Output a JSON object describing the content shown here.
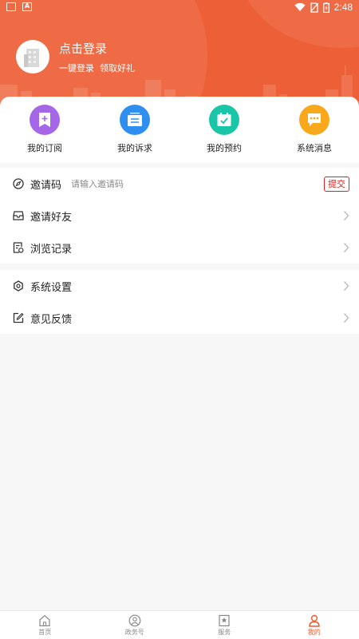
{
  "status_bar": {
    "time": "2:48",
    "left_icons": [
      "image-notification-icon",
      "app-notification-icon"
    ],
    "right_icons": [
      "wifi-icon",
      "no-sim-icon",
      "battery-icon"
    ]
  },
  "header": {
    "login_title": "点击登录",
    "login_subtitle": "一键登录  领取好礼",
    "avatar_icon": "building-icon",
    "background_color": "#ed6037"
  },
  "quick_actions": [
    {
      "label": "我的订阅",
      "icon": "subscription-icon",
      "color": "#a566e8"
    },
    {
      "label": "我的诉求",
      "icon": "appeal-icon",
      "color": "#2f8ff0"
    },
    {
      "label": "我的预约",
      "icon": "appointment-icon",
      "color": "#19c6a8"
    },
    {
      "label": "系统消息",
      "icon": "message-icon",
      "color": "#f8a81a"
    }
  ],
  "invite_code": {
    "label": "邀请码",
    "placeholder": "请输入邀请码",
    "submit_label": "提交"
  },
  "menu_group_1": [
    {
      "label": "邀请好友",
      "icon": "invite-friend-icon"
    },
    {
      "label": "浏览记录",
      "icon": "history-icon"
    }
  ],
  "menu_group_2": [
    {
      "label": "系统设置",
      "icon": "settings-icon"
    },
    {
      "label": "意见反馈",
      "icon": "feedback-icon"
    }
  ],
  "bottom_nav": [
    {
      "label": "首页",
      "icon": "home-icon",
      "active": false
    },
    {
      "label": "政务号",
      "icon": "gov-account-icon",
      "active": false
    },
    {
      "label": "服务",
      "icon": "service-icon",
      "active": false
    },
    {
      "label": "我的",
      "icon": "profile-icon",
      "active": true
    }
  ],
  "colors": {
    "accent": "#e8592f",
    "submit_border": "#e02020",
    "page_background": "#f7f7f7"
  }
}
